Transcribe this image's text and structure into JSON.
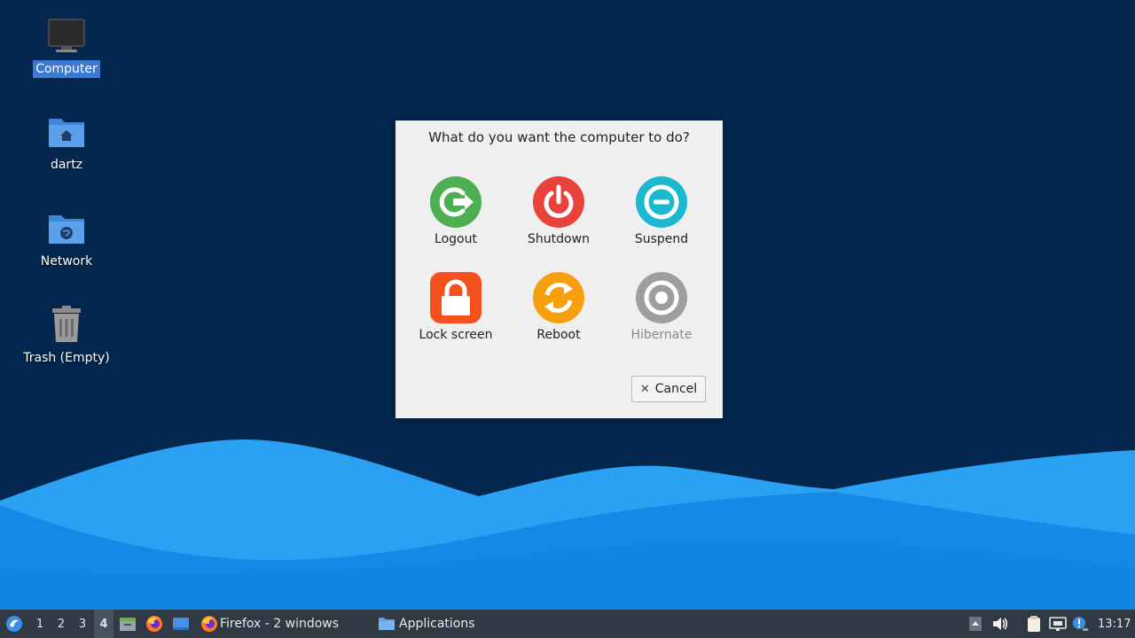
{
  "desktop": {
    "icons": [
      {
        "label": "Computer"
      },
      {
        "label": "dartz"
      },
      {
        "label": "Network"
      },
      {
        "label": "Trash (Empty)"
      }
    ]
  },
  "dialog": {
    "title": "What do you want the computer to do?",
    "actions": [
      {
        "label": "Logout",
        "color": "#4caf50",
        "icon": "logout-icon"
      },
      {
        "label": "Shutdown",
        "color": "#e9423a",
        "icon": "power-icon"
      },
      {
        "label": "Suspend",
        "color": "#1cb8d2",
        "icon": "suspend-icon"
      },
      {
        "label": "Lock screen",
        "color": "#f4511e",
        "icon": "lock-icon"
      },
      {
        "label": "Reboot",
        "color": "#f7a00f",
        "icon": "reboot-icon"
      },
      {
        "label": "Hibernate",
        "color": "#9e9e9e",
        "icon": "hibernate-icon",
        "enabled": false
      }
    ],
    "cancel_label": "Cancel"
  },
  "taskbar": {
    "workspaces": [
      "1",
      "2",
      "3",
      "4"
    ],
    "active_workspace": "4",
    "tasks": [
      {
        "label": "Firefox - 2 windows"
      },
      {
        "label": "Applications"
      }
    ],
    "clock": "13:17"
  },
  "colors": {
    "desktop_bg": "#03274e",
    "wave_light": "#2aa1f2",
    "wave_mid": "#1387e6",
    "taskbar_bg": "#2f3a45",
    "selection": "#3c79d6"
  }
}
